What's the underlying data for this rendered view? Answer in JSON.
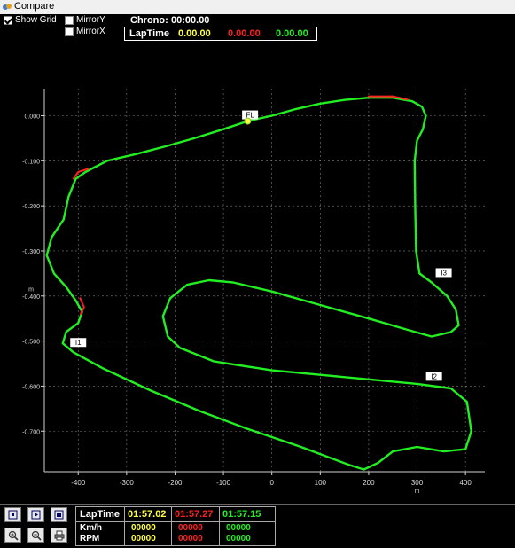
{
  "window": {
    "title": "Compare"
  },
  "options": {
    "show_grid": {
      "label": "Show Grid",
      "checked": true
    },
    "mirror_y": {
      "label": "MirrorY",
      "checked": false
    },
    "mirror_x": {
      "label": "MirrorX",
      "checked": false
    }
  },
  "chrono": {
    "label": "Chrono:",
    "value": "00:00.00"
  },
  "laptime_header": {
    "label": "LapTime",
    "values": [
      "0.00.00",
      "0.00.00",
      "0.00.00"
    ]
  },
  "colors": {
    "lap1": "#ffff44",
    "lap2": "#ff2020",
    "lap3": "#22ee22",
    "grid": "#cfcfcf",
    "axis": "#cfcfcf"
  },
  "chart_data": {
    "type": "line",
    "xlabel": "m",
    "ylabel": "m",
    "xlim": [
      -470,
      440
    ],
    "ylim": [
      -0.79,
      0.06
    ],
    "x_ticks": [
      -400,
      -300,
      -200,
      -100,
      0,
      100,
      200,
      300,
      400
    ],
    "y_ticks": [
      0.0,
      -0.1,
      -0.2,
      -0.3,
      -0.4,
      -0.5,
      -0.6,
      -0.7
    ],
    "x_tick_labels": [
      "-400",
      "-300",
      "-200",
      "-100",
      "0",
      "100",
      "200",
      "300",
      "400"
    ],
    "y_tick_labels": [
      "0.000",
      "-0.100",
      "-0.200",
      "-0.300",
      "-0.400",
      "-0.500",
      "-0.600",
      "-0.700"
    ],
    "grid": true,
    "markers": [
      {
        "label": "FL",
        "x": -45,
        "y": -0.01
      },
      {
        "label": "I1",
        "x": -400,
        "y": -0.515
      },
      {
        "label": "I2",
        "x": 335,
        "y": -0.59
      },
      {
        "label": "I3",
        "x": 355,
        "y": -0.36
      }
    ],
    "current_position": {
      "x": -50,
      "y": -0.012
    },
    "series": [
      {
        "color": "#22ee22",
        "points": [
          [
            -50,
            -0.012
          ],
          [
            0,
            0.0
          ],
          [
            50,
            0.015
          ],
          [
            100,
            0.027
          ],
          [
            150,
            0.035
          ],
          [
            200,
            0.04
          ],
          [
            250,
            0.04
          ],
          [
            290,
            0.032
          ],
          [
            310,
            0.02
          ],
          [
            318,
            0.0
          ],
          [
            312,
            -0.03
          ],
          [
            300,
            -0.055
          ],
          [
            295,
            -0.1
          ],
          [
            296,
            -0.2
          ],
          [
            298,
            -0.3
          ],
          [
            305,
            -0.35
          ],
          [
            330,
            -0.37
          ],
          [
            362,
            -0.4
          ],
          [
            380,
            -0.43
          ],
          [
            386,
            -0.465
          ],
          [
            370,
            -0.48
          ],
          [
            330,
            -0.49
          ],
          [
            280,
            -0.475
          ],
          [
            200,
            -0.45
          ],
          [
            100,
            -0.42
          ],
          [
            0,
            -0.39
          ],
          [
            -80,
            -0.37
          ],
          [
            -130,
            -0.365
          ],
          [
            -175,
            -0.375
          ],
          [
            -210,
            -0.405
          ],
          [
            -225,
            -0.445
          ],
          [
            -215,
            -0.49
          ],
          [
            -190,
            -0.515
          ],
          [
            -120,
            -0.545
          ],
          [
            0,
            -0.565
          ],
          [
            100,
            -0.575
          ],
          [
            200,
            -0.585
          ],
          [
            300,
            -0.595
          ],
          [
            370,
            -0.605
          ],
          [
            403,
            -0.635
          ],
          [
            412,
            -0.7
          ],
          [
            400,
            -0.74
          ],
          [
            355,
            -0.745
          ],
          [
            300,
            -0.735
          ],
          [
            250,
            -0.745
          ],
          [
            220,
            -0.77
          ],
          [
            190,
            -0.785
          ],
          [
            160,
            -0.775
          ],
          [
            60,
            -0.735
          ],
          [
            -50,
            -0.695
          ],
          [
            -150,
            -0.655
          ],
          [
            -250,
            -0.61
          ],
          [
            -350,
            -0.56
          ],
          [
            -410,
            -0.525
          ],
          [
            -432,
            -0.505
          ],
          [
            -425,
            -0.48
          ],
          [
            -400,
            -0.46
          ],
          [
            -392,
            -0.435
          ],
          [
            -405,
            -0.41
          ],
          [
            -425,
            -0.38
          ],
          [
            -450,
            -0.35
          ],
          [
            -465,
            -0.31
          ],
          [
            -455,
            -0.27
          ],
          [
            -430,
            -0.23
          ],
          [
            -420,
            -0.18
          ],
          [
            -405,
            -0.14
          ],
          [
            -385,
            -0.125
          ],
          [
            -340,
            -0.1
          ],
          [
            -280,
            -0.085
          ],
          [
            -220,
            -0.068
          ],
          [
            -160,
            -0.05
          ],
          [
            -100,
            -0.03
          ],
          [
            -50,
            -0.012
          ]
        ]
      },
      {
        "color": "#ff2020",
        "points": [
          [
            200,
            0.043
          ],
          [
            250,
            0.043
          ],
          [
            280,
            0.036
          ]
        ]
      },
      {
        "color": "#ff2020",
        "points": [
          [
            -395,
            -0.44
          ],
          [
            -388,
            -0.425
          ],
          [
            -396,
            -0.405
          ]
        ]
      },
      {
        "color": "#ff2020",
        "points": [
          [
            -410,
            -0.14
          ],
          [
            -400,
            -0.125
          ],
          [
            -380,
            -0.118
          ]
        ]
      }
    ]
  },
  "toolbar": {
    "buttons": [
      "zoom-extents-icon",
      "play-icon",
      "fit-icon",
      "zoom-in-icon",
      "zoom-out-icon",
      "print-icon"
    ]
  },
  "stats": {
    "row_labels": [
      "LapTime",
      "Km/h",
      "RPM"
    ],
    "laps": [
      {
        "laptime": "01:57.02",
        "kmh": "00000",
        "rpm": "00000",
        "color": "#ffff44"
      },
      {
        "laptime": "01:57.27",
        "kmh": "00000",
        "rpm": "00000",
        "color": "#ff2020"
      },
      {
        "laptime": "01:57.15",
        "kmh": "00000",
        "rpm": "00000",
        "color": "#22ee22"
      }
    ]
  }
}
